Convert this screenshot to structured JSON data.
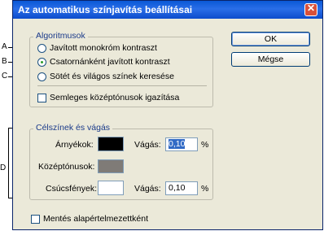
{
  "dialog": {
    "title": "Az automatikus színjavítás beállításai"
  },
  "callouts": {
    "a": "A",
    "b": "B",
    "c": "C",
    "d": "D"
  },
  "algorithms": {
    "legend": "Algoritmusok",
    "options": [
      {
        "label": "Javított monokróm kontraszt",
        "selected": false
      },
      {
        "label": "Csatornánként javított kontraszt",
        "selected": true
      },
      {
        "label": "Sötét és világos színek keresése",
        "selected": false
      }
    ],
    "snap_neutral": {
      "label": "Semleges középtónusok igazítása",
      "checked": false
    }
  },
  "targets": {
    "legend": "Célszínek és vágás",
    "shadows": {
      "label": "Árnyékok:",
      "color": "#000000",
      "clip_label": "Vágás:",
      "clip_value": "0,10",
      "unit": "%"
    },
    "midtones": {
      "label": "Középtónusok:",
      "color": "#7f7b77"
    },
    "highlights": {
      "label": "Csúcsfények:",
      "color": "#ffffff",
      "clip_label": "Vágás:",
      "clip_value": "0,10",
      "unit": "%"
    }
  },
  "save_defaults": {
    "label": "Mentés alapértelmezettként",
    "checked": false
  },
  "buttons": {
    "ok": "OK",
    "cancel": "Mégse"
  }
}
